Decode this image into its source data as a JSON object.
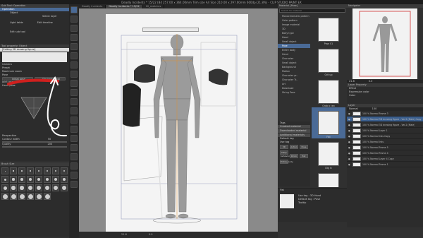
{
  "window": {
    "title": "Deadly Incidents * 15/22 (B4 257.00 x 364.00mm Trim size A4 Size 210.00 x 297.00mm 600dpi 21.8%) - CLIP STUDIO PAINT EX"
  },
  "tool_panel": {
    "title": "Sub Tool: Operation",
    "items": [
      "Operation",
      "Object",
      "Select layer",
      "Light table",
      "Edit timeline"
    ],
    "add_label": "Edit sub tool"
  },
  "tool_property": {
    "title": "Tool property: Object",
    "subtitle": "[Editing 3D drawing figure]",
    "rows": [
      "Camera",
      "Preset",
      "Maximum zoom",
      "Pose"
    ],
    "pose_btn": "Initial pose",
    "flip_btn": "Flip horizontal",
    "joint_label": "Joint angle limit",
    "hand_label": "Hand pose",
    "perspective": "Perspective",
    "contour": "Contour width",
    "contour_val": "50",
    "quality": "Quality",
    "quality_val": "200"
  },
  "brush_panel": {
    "title": "Brush Size",
    "sizes": [
      "1",
      "2",
      "3",
      "4",
      "5",
      "6",
      "7",
      "8",
      "10",
      "12",
      "15",
      "17",
      "20",
      "25",
      "30",
      "40",
      "50",
      "60",
      "70",
      "80",
      "100",
      "120",
      "150",
      "170",
      "200",
      "250",
      "300",
      "400",
      "500",
      "700"
    ]
  },
  "doc_tabs": [
    "Deadly Incidents",
    "Deadly Incidents * 15/22",
    "20_sketches"
  ],
  "canvas": {
    "zoom": "21.8",
    "angle": "0.0"
  },
  "material": {
    "title": "Material [Pose]",
    "search_placeholder": "Search for material",
    "tree": [
      "Monochromatic pattern",
      "Color pattern",
      "Image material",
      "3D",
      "Body type",
      "Head",
      "Small object",
      "Pose",
      "Entire body",
      "Hand",
      "Character",
      "Small object",
      "Background",
      "Motion",
      "Character pr..",
      "Character Tr..",
      "Art",
      "Download",
      "String Pose"
    ],
    "items": [
      "Pose 01",
      "Grit up",
      "Grab a can",
      "Fist",
      "Dig in",
      "Take notes",
      "Strength test"
    ],
    "tags_title": "Tags",
    "tags": [
      "Created material",
      "Downloaded material",
      "Additional materials"
    ],
    "default_tag": "Default tag",
    "use_tag": "Use tag",
    "tag_values": [
      "3D",
      "Action",
      "Pose",
      "Daily behavior",
      "Drink",
      "Eat",
      "Entire_body"
    ],
    "detail_name": "Fist",
    "detail_rows": [
      "Use tag : 3D Hand",
      "Default tag : Pose",
      "Tooltip"
    ]
  },
  "navigator": {
    "title": "Navigator",
    "zoom": "21.8",
    "angle": "0.0"
  },
  "layer_property": {
    "title": "Layer Property",
    "effect": "Effect",
    "expression": "Expression color",
    "color": "Color"
  },
  "layers": {
    "title": "Layer",
    "blend": "Normal",
    "opacity": "100",
    "rows": [
      {
        "name": "100 % Normal Frame 3",
        "sel": false
      },
      {
        "name": "100 % Normal 3D drawing figure - Ver.2 (Male) Copy",
        "sel": true
      },
      {
        "name": "100 % Normal 3D drawing figure - Ver.2 (Male)",
        "sel": false
      },
      {
        "name": "100 % Normal Layer 1",
        "sel": false
      },
      {
        "name": "100 % Normal Inks Copy",
        "sel": false
      },
      {
        "name": "100 % Normal Inks",
        "sel": false
      },
      {
        "name": "100 % Normal Frame 5",
        "sel": false
      },
      {
        "name": "100 % Normal Frame 4",
        "sel": false
      },
      {
        "name": "100 % Normal Layer 4 Copy",
        "sel": false
      },
      {
        "name": "100 % Normal Frame 1",
        "sel": false
      }
    ]
  },
  "colors": {
    "accent": "#4a6a96",
    "bg": "#2b2b2b",
    "canvas": "#8a8a8a",
    "red_stroke": "#d0201e"
  }
}
